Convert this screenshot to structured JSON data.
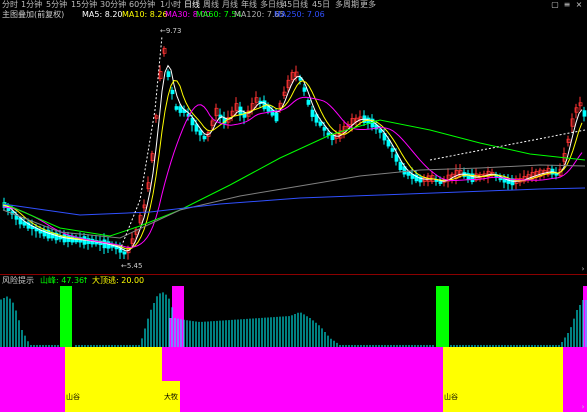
{
  "period_tabs": [
    "分时",
    "1分钟",
    "5分钟",
    "15分钟",
    "30分钟",
    "60分钟",
    "1小时",
    "日线",
    "周线",
    "月线",
    "年线",
    "多日线",
    "45日线",
    "45日",
    "多周期",
    "更多"
  ],
  "active_tab_index": 7,
  "window_buttons": {
    "restore": "▢",
    "menu": "≡",
    "close": "×"
  },
  "main_header": {
    "indicator": "主图叠加(前复权)",
    "ma5": "MA5: 8.20",
    "ma10": "MA10: 8.26",
    "ma30": "MA30: 8.00",
    "ma60": "MA60: 7.54",
    "ma120": "MA120: 7.65",
    "ma250": "MA250: 7.06"
  },
  "price_labels": {
    "high": "←9.73",
    "low": "←5.45"
  },
  "sub_header": {
    "name": "风险提示",
    "mountain": "山峰: 47.36",
    "mountain_arrow": "↑",
    "top_escape": "大顶逃: 20.00"
  },
  "sub_labels": {
    "left": "山谷",
    "mid": "大牧",
    "right": "山谷"
  },
  "colors": {
    "bg": "#000000",
    "up": "#ff3333",
    "down": "#00ffff",
    "ma5": "#ffffff",
    "ma10": "#ffff00",
    "ma30": "#ff00ff",
    "ma60": "#00ff00",
    "ma120": "#808080",
    "ma250": "#3050ff",
    "magenta": "#ff00ff",
    "yellow": "#ffff00",
    "green": "#00ff00",
    "cyan": "#00ffff"
  }
}
